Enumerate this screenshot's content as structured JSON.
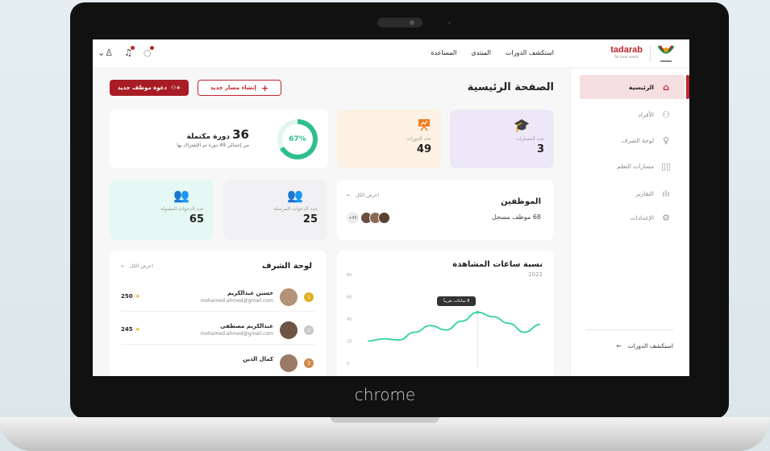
{
  "device": {
    "brand": "chrome"
  },
  "nav": {
    "links": [
      "استكشف الدورات",
      "المنتدى",
      "المساعدة"
    ],
    "logo_text": "tadarab",
    "logo_sub": "for local needs"
  },
  "sidebar": {
    "items": [
      {
        "label": "الرئيسية",
        "icon": "home-icon",
        "active": true
      },
      {
        "label": "الأفراد",
        "icon": "users-icon",
        "active": false
      },
      {
        "label": "لوحة الشرف",
        "icon": "medal-icon",
        "active": false
      },
      {
        "label": "مسارات التعلم",
        "icon": "book-icon",
        "active": false
      },
      {
        "label": "التقارير",
        "icon": "chart-bar-icon",
        "active": false
      },
      {
        "label": "الإعدادات",
        "icon": "gear-icon",
        "active": false
      }
    ],
    "bottom_link": "استكشف الدورات"
  },
  "header": {
    "title": "الصفحة الرئيسية",
    "btn_invite": "دعوة موظف جديد",
    "btn_path": "إنشاء مسار جديد"
  },
  "stats": {
    "paths": {
      "label": "عدد المسارات",
      "value": "3"
    },
    "courses": {
      "label": "عدد الدورات",
      "value": "49"
    },
    "complete": {
      "count": "36",
      "title": "دورة مكتملة",
      "sub": "من إجمالي 49 دورة تم الإشتراك بها",
      "percent": "67%",
      "fraction": 0.67
    },
    "accepted": {
      "label": "عدد الدعوات المقبولة",
      "value": "65"
    },
    "sent": {
      "label": "عدد الدعوات المرسلة",
      "value": "25"
    }
  },
  "employees": {
    "title": "الموظفين",
    "subtitle": "68 موظف مسجل",
    "view_all": "اعرض الكل",
    "more": "+45"
  },
  "leaderboard": {
    "title": "لوحة الشرف",
    "view_all": "اعرض الكل",
    "rows": [
      {
        "name": "حسين عبدالكريم",
        "email": "mohamed.ahmed@gmail.com",
        "score": "250",
        "rank": "1"
      },
      {
        "name": "عبدالكريم مصطفى",
        "email": "mohamed.ahmed@gmail.com",
        "score": "245",
        "rank": "2"
      },
      {
        "name": "كمال الدين",
        "email": "",
        "score": "",
        "rank": "3"
      }
    ]
  },
  "chart": {
    "title": "نسبة ساعات المشاهدة",
    "year": "2022",
    "tooltip": "8 ساعات تقريباً"
  },
  "chart_data": {
    "type": "line",
    "title": "نسبة ساعات المشاهدة",
    "subtitle": "2022",
    "ylim": [
      0,
      80
    ],
    "yticks": [
      "80",
      "60",
      "40",
      "20",
      "0"
    ],
    "series": [
      {
        "color": "#2fd39b",
        "values": [
          20,
          22,
          21,
          28,
          34,
          30,
          38,
          46,
          42,
          36,
          28,
          35
        ]
      }
    ],
    "grid": false
  }
}
